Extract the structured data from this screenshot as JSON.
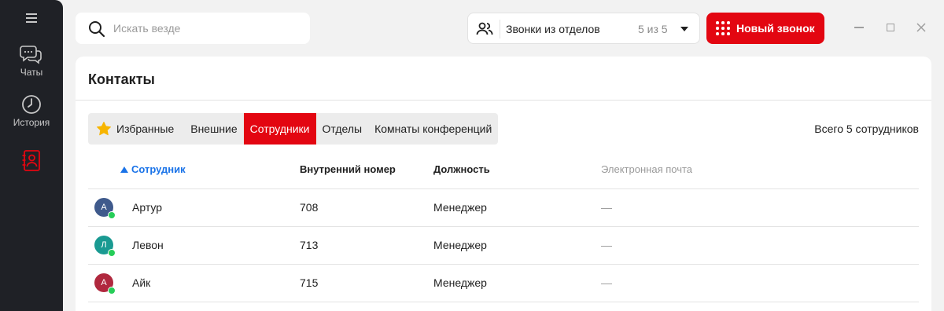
{
  "sidebar": {
    "items": [
      {
        "label": "Чаты",
        "icon": "chats-icon"
      },
      {
        "label": "История",
        "icon": "history-icon"
      },
      {
        "label": "",
        "icon": "contacts-icon"
      }
    ],
    "accent": "#e30611"
  },
  "search": {
    "placeholder": "Искать везде",
    "value": ""
  },
  "dept_selector": {
    "label": "Звонки из отделов",
    "count": "5 из 5"
  },
  "new_call": {
    "label": "Новый звонок"
  },
  "panel": {
    "title": "Контакты",
    "tabs": [
      {
        "label": "Избранные"
      },
      {
        "label": "Внешние"
      },
      {
        "label": "Сотрудники",
        "active": true
      },
      {
        "label": "Отделы"
      },
      {
        "label": "Комнаты конференций"
      }
    ],
    "total": "Всего 5 сотрудников",
    "columns": {
      "employee": "Сотрудник",
      "ext": "Внутренний номер",
      "position": "Должность",
      "email": "Электронная почта"
    },
    "rows": [
      {
        "initial": "А",
        "name": "Артур",
        "ext": "708",
        "position": "Менеджер",
        "email": "—",
        "avatar_color": "#3f5a8c"
      },
      {
        "initial": "Л",
        "name": "Левон",
        "ext": "713",
        "position": "Менеджер",
        "email": "—",
        "avatar_color": "#1a9a92"
      },
      {
        "initial": "А",
        "name": "Айк",
        "ext": "715",
        "position": "Менеджер",
        "email": "—",
        "avatar_color": "#b0283e"
      }
    ]
  }
}
